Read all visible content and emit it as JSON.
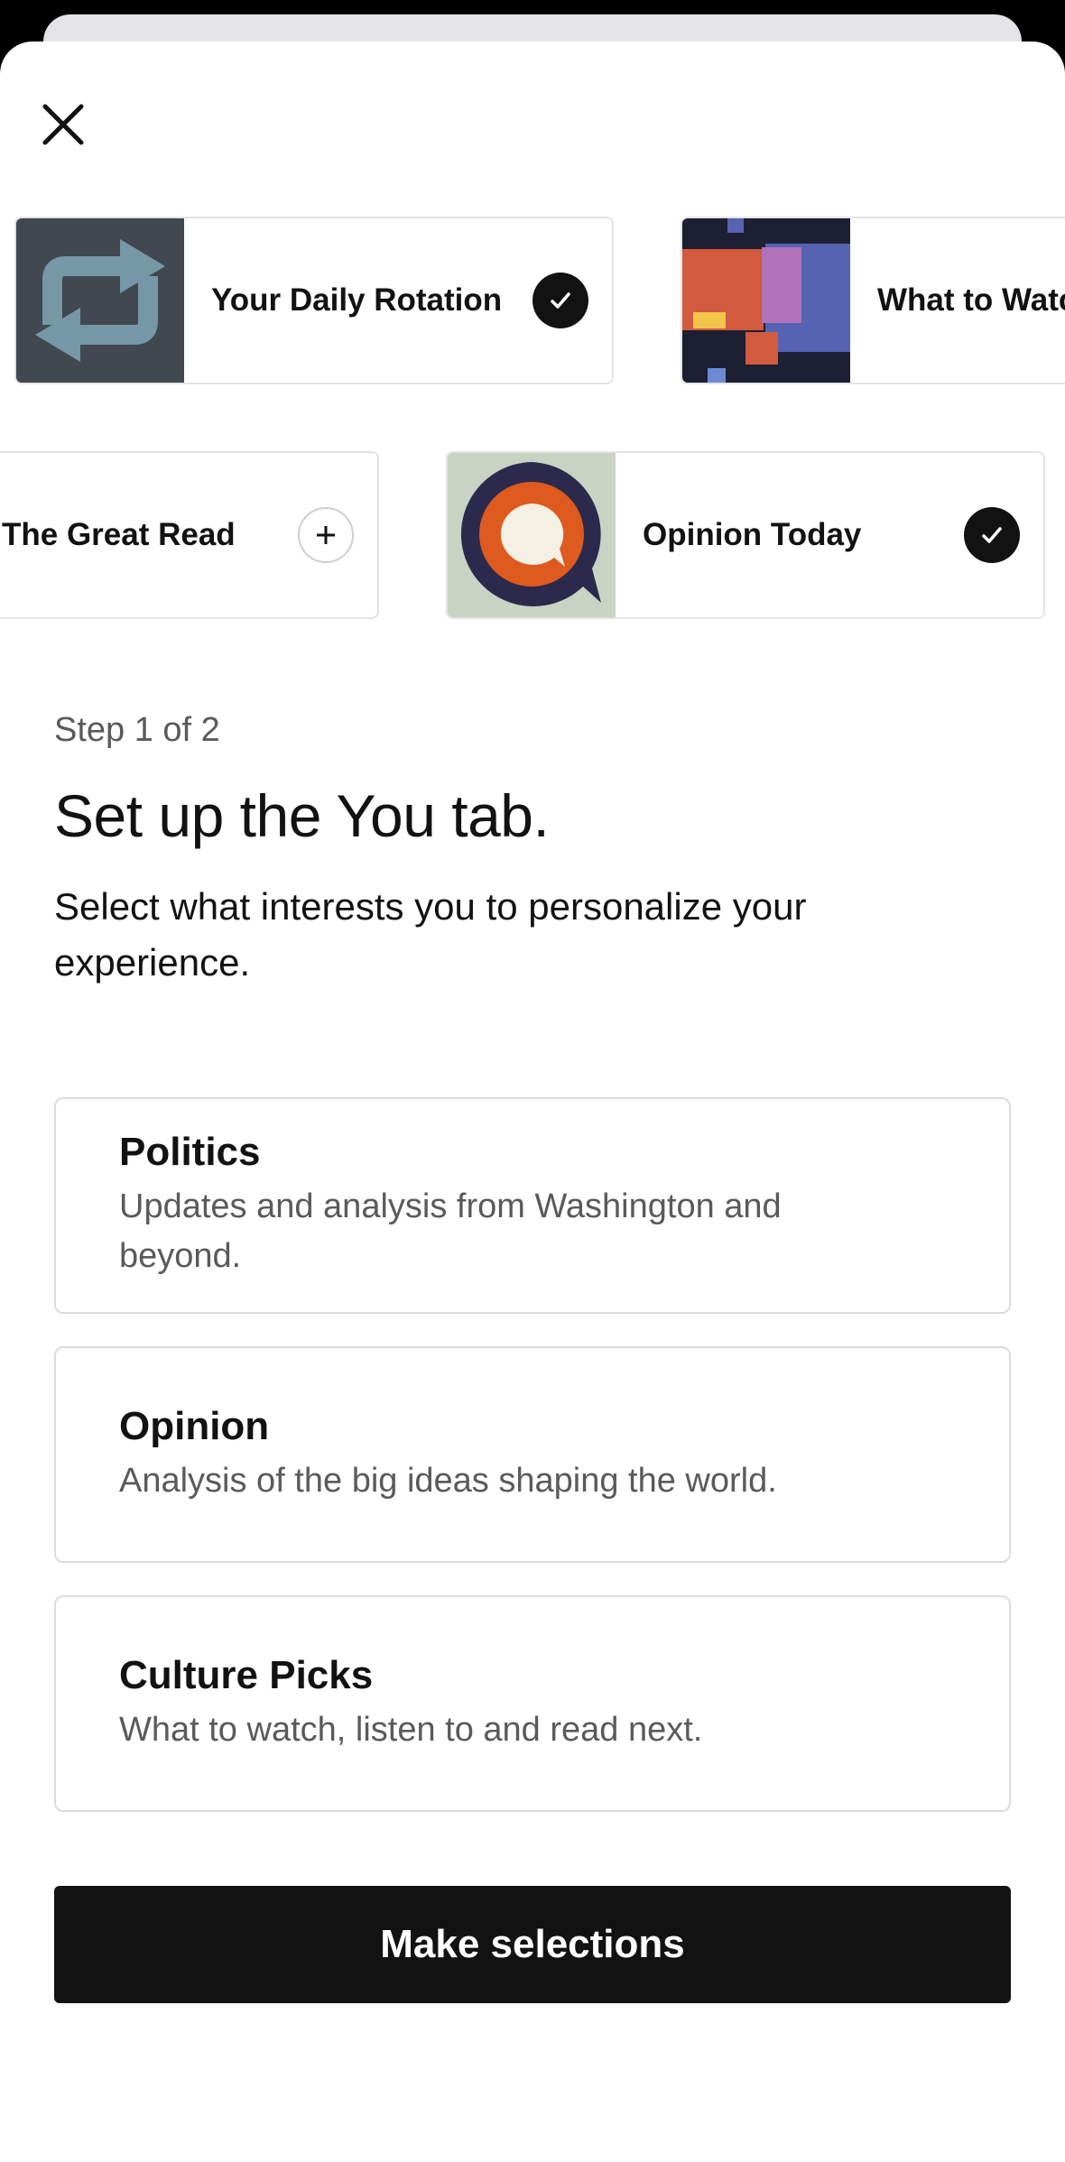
{
  "newsletters_row1": [
    {
      "title": "Your Daily Rotation",
      "state": "selected",
      "icon": "rotation-arrows-icon"
    },
    {
      "title": "What to Watch",
      "state": "unselected",
      "icon": "color-blocks-art-icon"
    }
  ],
  "newsletters_row2": [
    {
      "title": "The Great Read",
      "state": "unselected",
      "icon": "plus-icon"
    },
    {
      "title": "Opinion Today",
      "state": "selected",
      "icon": "speech-bubble-icon"
    }
  ],
  "onboarding": {
    "step": "Step 1 of 2",
    "heading": "Set up the You tab.",
    "subtitle": "Select what interests you to personalize your experience."
  },
  "topics": [
    {
      "title": "Politics",
      "description": "Updates and analysis from Washington and beyond."
    },
    {
      "title": "Opinion",
      "description": "Analysis of the big ideas shaping the world."
    },
    {
      "title": "Culture Picks",
      "description": "What to watch, listen to and read next."
    }
  ],
  "cta": {
    "label": "Make selections"
  },
  "colors": {
    "primary": "#121212",
    "muted_text": "#5a5a5a",
    "border": "#dcdcdc",
    "accent_orange": "#de5a1f",
    "navy": "#2b2a4c"
  }
}
